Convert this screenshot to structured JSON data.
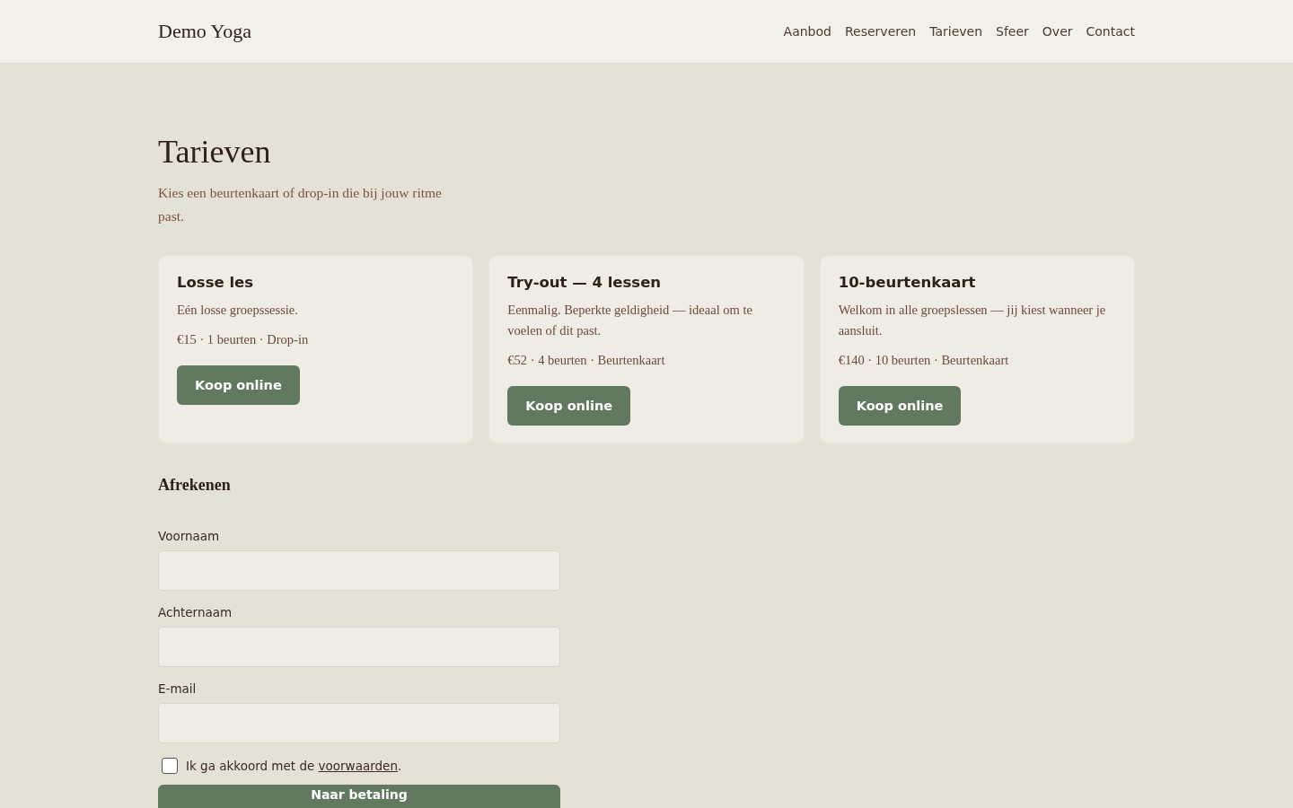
{
  "header": {
    "logo": "Demo Yoga",
    "nav": [
      {
        "label": "Aanbod"
      },
      {
        "label": "Reserveren"
      },
      {
        "label": "Tarieven"
      },
      {
        "label": "Sfeer"
      },
      {
        "label": "Over"
      },
      {
        "label": "Contact"
      }
    ]
  },
  "page": {
    "title": "Tarieven",
    "intro": "Kies een beurtenkaart of drop-in die bij jouw ritme past."
  },
  "plans": [
    {
      "name": "Losse les",
      "description": "Eén losse groepssessie.",
      "details": "€15 · 1 beurten · Drop-in",
      "button": "Koop online"
    },
    {
      "name": "Try-out — 4 lessen",
      "description": "Eenmalig. Beperkte geldigheid — ideaal om te voelen of dit past.",
      "details": "€52 · 4 beurten · Beurtenkaart",
      "button": "Koop online"
    },
    {
      "name": "10-beurtenkaart",
      "description": "Welkom in alle groepslessen — jij kiest wanneer je aansluit.",
      "details": "€140 · 10 beurten · Beurtenkaart",
      "button": "Koop online"
    }
  ],
  "checkout": {
    "title": "Afrekenen",
    "fields": [
      {
        "label": "Voornaam"
      },
      {
        "label": "Achternaam"
      },
      {
        "label": "E-mail"
      }
    ],
    "consent": {
      "checked": false,
      "text_before": "Ik ga akkoord met de ",
      "link": "voorwaarden",
      "text_after": "."
    },
    "submit": "Naar betaling"
  }
}
